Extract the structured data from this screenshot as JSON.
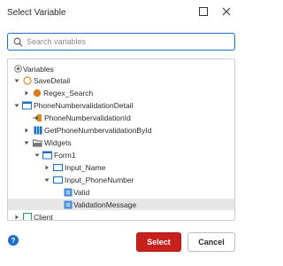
{
  "dialog": {
    "title": "Select Variable"
  },
  "search": {
    "placeholder": "Search variables",
    "value": ""
  },
  "tree": {
    "nodes": [
      {
        "label": "Variables"
      },
      {
        "label": "SaveDetail"
      },
      {
        "label": "Regex_Search"
      },
      {
        "label": "PhoneNumbervalidationDetail"
      },
      {
        "label": "PhoneNumbervalidationId"
      },
      {
        "label": "GetPhoneNumbervalidationById"
      },
      {
        "label": "Widgets"
      },
      {
        "label": "Form1"
      },
      {
        "label": "Input_Name"
      },
      {
        "label": "Input_PhoneNumber"
      },
      {
        "label": "Valid"
      },
      {
        "label": "ValidationMessage"
      },
      {
        "label": "Client"
      }
    ],
    "selected": "ValidationMessage"
  },
  "footer": {
    "help_label": "?",
    "select_label": "Select",
    "cancel_label": "Cancel"
  },
  "colors": {
    "accent": "#1a6fc9",
    "primary_button": "#c8201c",
    "selected_row": "#e6e6e6"
  }
}
